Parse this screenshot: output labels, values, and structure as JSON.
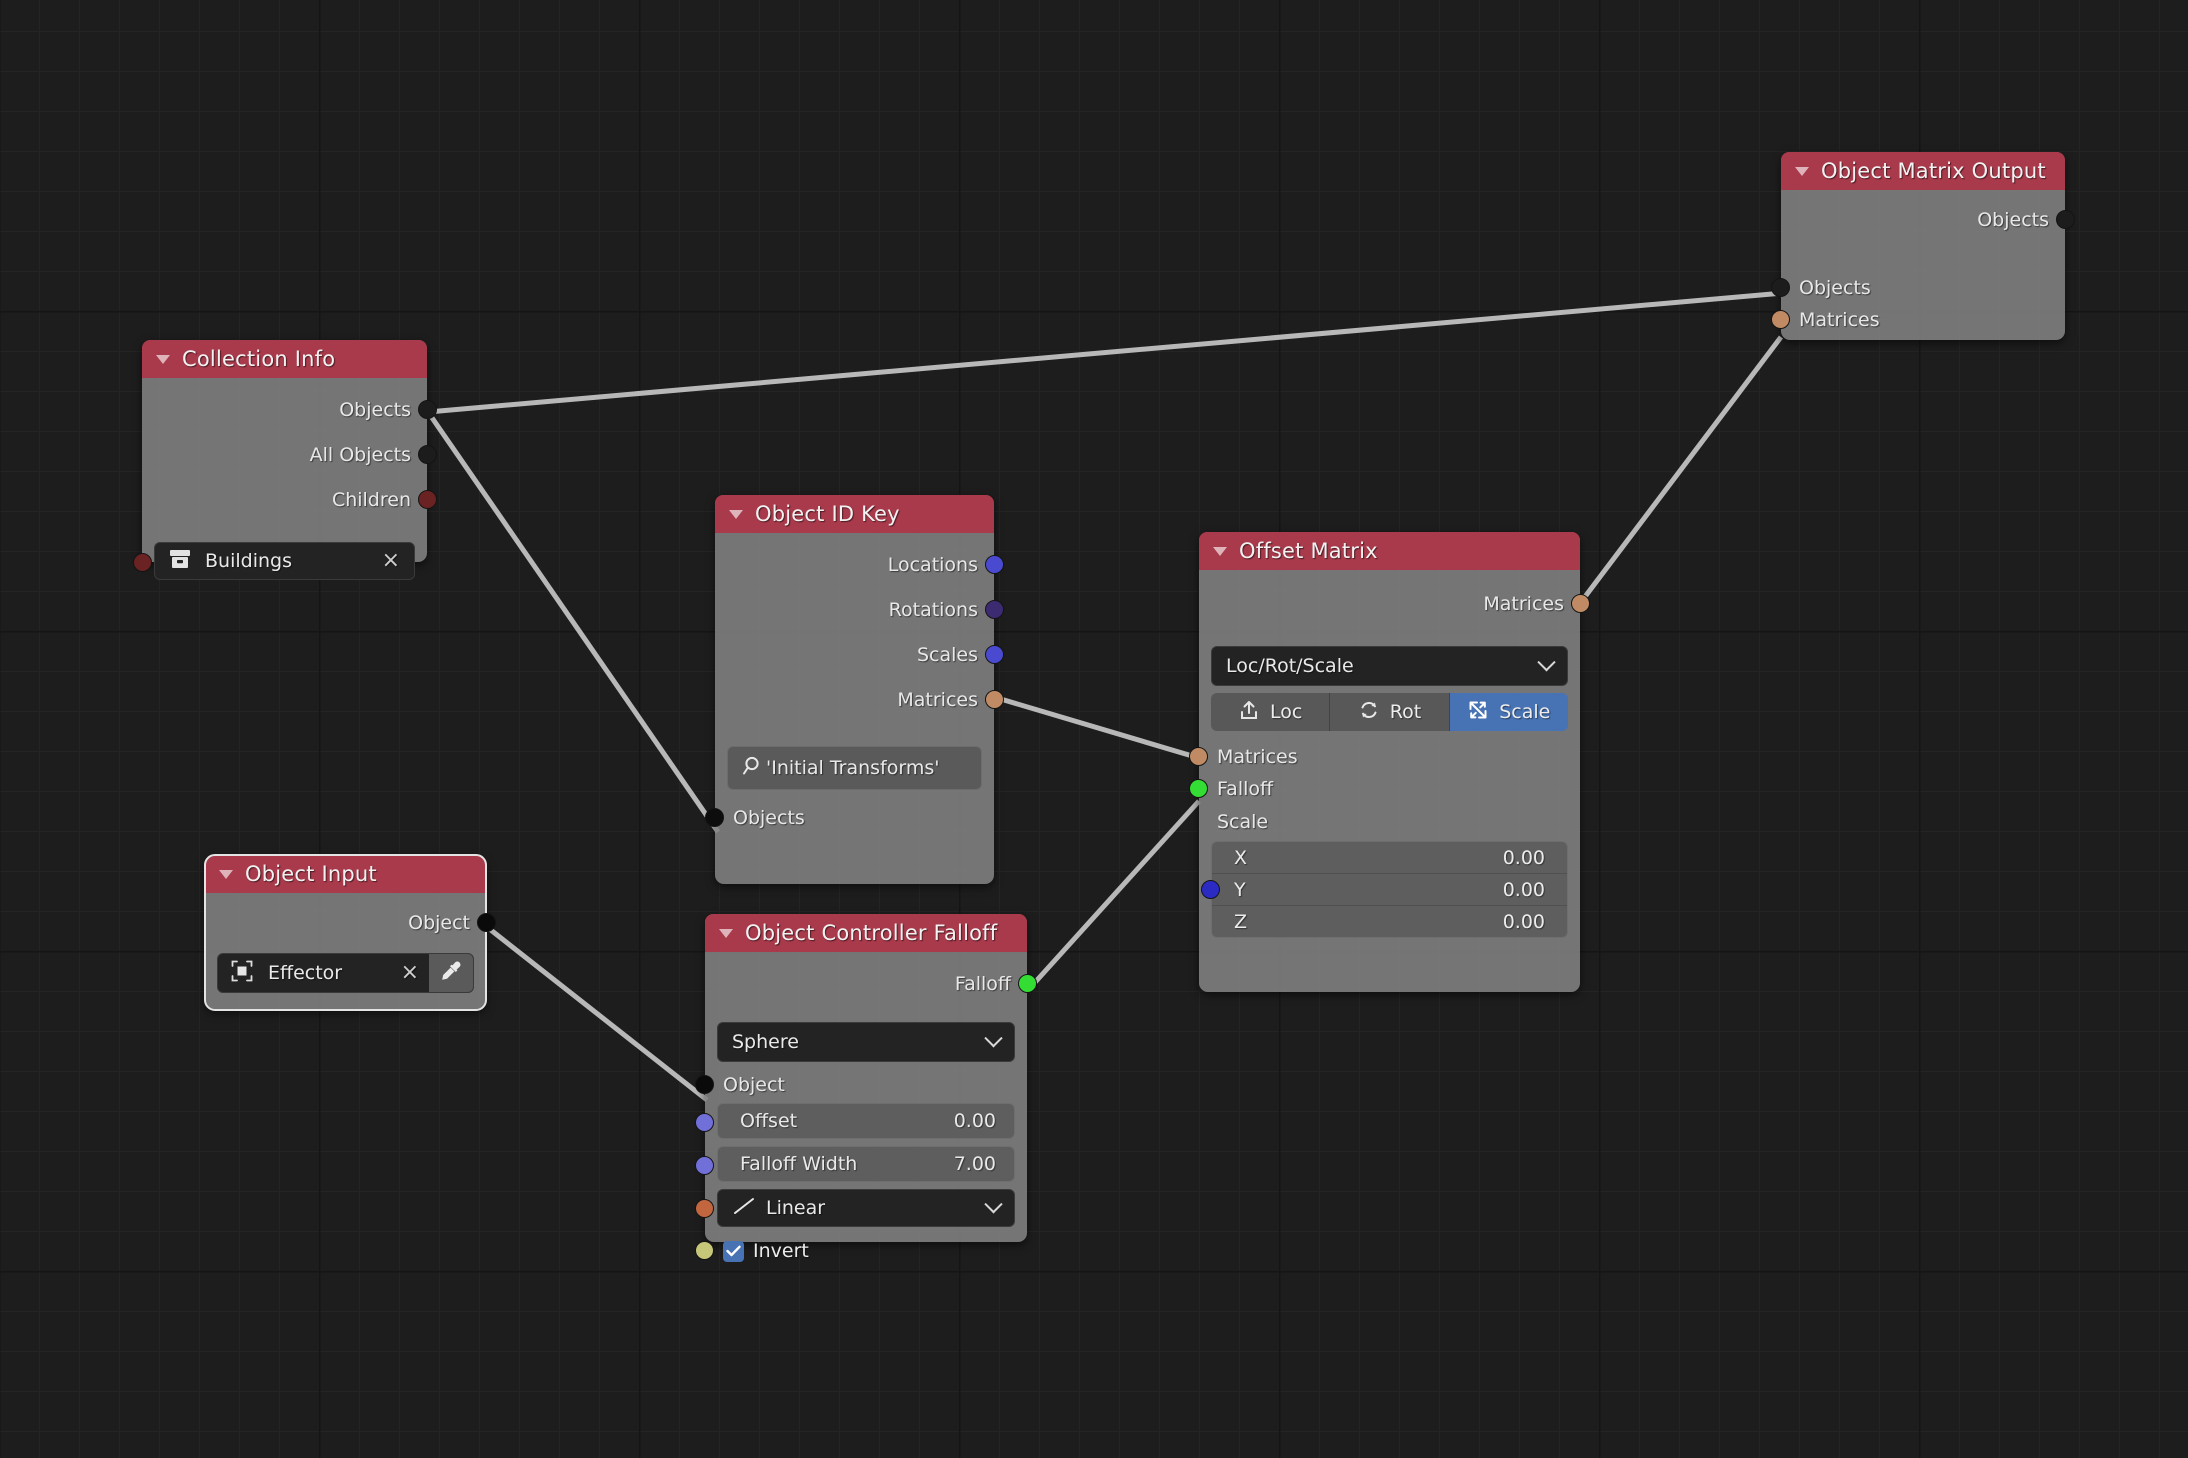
{
  "editor": {
    "name": "node-editor-canvas",
    "background": "#1d1d1d",
    "grid_color": "#242424",
    "grid_major_color": "#151515"
  },
  "colors": {
    "node_header": "#a83a4b",
    "node_body": "rgba(130,130,130,0.88)",
    "accent_blue": "#4772b3",
    "socket_geometry": "#1c1c1c",
    "socket_collection": "#6b2222",
    "socket_matrix": "#c08b64",
    "socket_vector": "#6363c7",
    "socket_rotation": "#3d2b72",
    "socket_float_green": "#33dd33",
    "socket_object": "#0a0a0a",
    "socket_periwinkle": "#7070d8",
    "socket_orange_red": "#c1663f",
    "socket_yellow": "#c7c77a",
    "wire": "#b4b4b4"
  },
  "nodes": [
    {
      "id": "object-matrix-output",
      "title": "Object Matrix Output",
      "outputs": [
        {
          "label": "Objects",
          "socket": "geometry"
        }
      ],
      "inputs": [
        {
          "label": "Objects",
          "socket": "geometry"
        },
        {
          "label": "Matrices",
          "socket": "matrix"
        }
      ]
    },
    {
      "id": "collection-info",
      "title": "Collection Info",
      "outputs": [
        {
          "label": "Objects",
          "socket": "geometry"
        },
        {
          "label": "All Objects",
          "socket": "geometry"
        },
        {
          "label": "Children",
          "socket": "collection"
        }
      ],
      "collection_field": {
        "icon": "collection-icon",
        "value": "Buildings",
        "clear_label": "×"
      }
    },
    {
      "id": "object-id-key",
      "title": "Object ID Key",
      "outputs": [
        {
          "label": "Locations",
          "socket": "vector"
        },
        {
          "label": "Rotations",
          "socket": "rotation"
        },
        {
          "label": "Scales",
          "socket": "vector"
        },
        {
          "label": "Matrices",
          "socket": "matrix"
        }
      ],
      "search_field": {
        "icon": "search-icon",
        "value": "'Initial Transforms'"
      },
      "inputs": [
        {
          "label": "Objects",
          "socket": "geometry"
        }
      ]
    },
    {
      "id": "offset-matrix",
      "title": "Offset Matrix",
      "outputs": [
        {
          "label": "Matrices",
          "socket": "matrix"
        }
      ],
      "mode_dropdown": {
        "value": "Loc/Rot/Scale",
        "icon": "chevron-down-icon"
      },
      "toggles": [
        {
          "label": "Loc",
          "icon": "loc-icon",
          "active": false
        },
        {
          "label": "Rot",
          "icon": "rot-icon",
          "active": false
        },
        {
          "label": "Scale",
          "icon": "scale-icon",
          "active": true
        }
      ],
      "inputs": [
        {
          "label": "Matrices",
          "socket": "matrix"
        },
        {
          "label": "Falloff",
          "socket": "float_green"
        }
      ],
      "scale_group": {
        "label": "Scale",
        "fields": [
          {
            "axis": "X",
            "value": "0.00"
          },
          {
            "axis": "Y",
            "value": "0.00"
          },
          {
            "axis": "Z",
            "value": "0.00"
          }
        ]
      }
    },
    {
      "id": "object-input",
      "title": "Object Input",
      "active": true,
      "outputs": [
        {
          "label": "Object",
          "socket": "object"
        }
      ],
      "object_field": {
        "icon": "object-icon",
        "value": "Effector",
        "clear_label": "×",
        "picker_icon": "eyedropper-icon"
      }
    },
    {
      "id": "object-controller-falloff",
      "title": "Object Controller Falloff",
      "outputs": [
        {
          "label": "Falloff",
          "socket": "float_green"
        }
      ],
      "shape_dropdown": {
        "value": "Sphere",
        "icon": "chevron-down-icon"
      },
      "object_row": {
        "label": "Object",
        "socket": "object"
      },
      "fields": [
        {
          "label": "Offset",
          "value": "0.00",
          "socket": "periwinkle"
        },
        {
          "label": "Falloff Width",
          "value": "7.00",
          "socket": "periwinkle"
        }
      ],
      "interpolation_dropdown": {
        "value": "Linear",
        "icon": "linear-curve-icon",
        "socket": "orange_red"
      },
      "invert_checkbox": {
        "label": "Invert",
        "checked": true,
        "socket": "yellow"
      }
    }
  ]
}
